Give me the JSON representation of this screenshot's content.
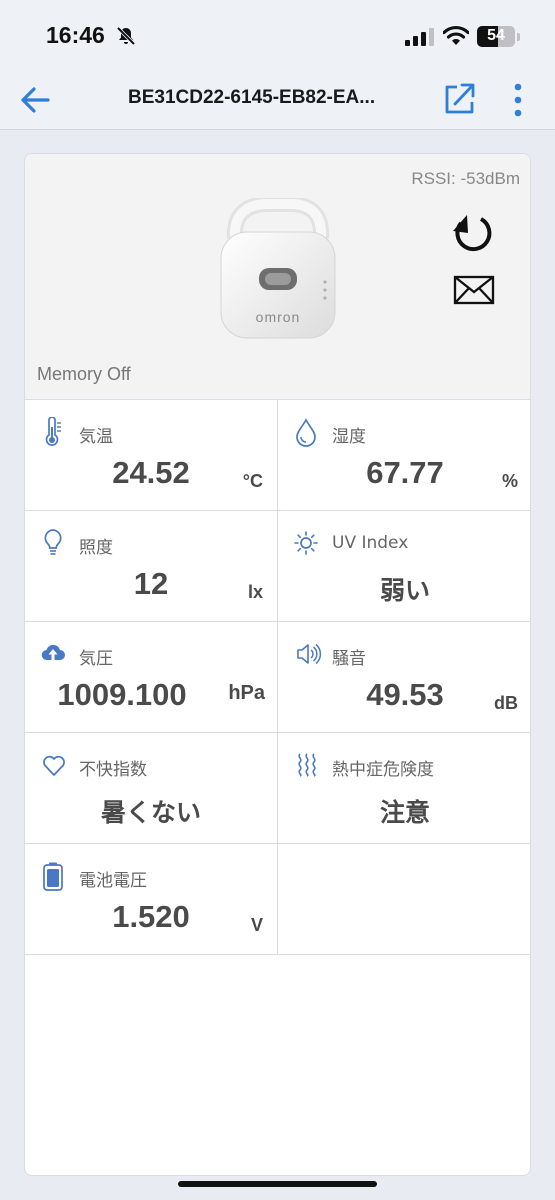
{
  "status_bar": {
    "time": "16:46",
    "battery_level": "54"
  },
  "nav": {
    "title": "BE31CD22-6145-EB82-EA..."
  },
  "device": {
    "rssi": "RSSI: -53dBm",
    "brand_label": "omron",
    "memory_status": "Memory Off"
  },
  "sensors": [
    {
      "label": "気温",
      "value": "24.52",
      "unit": "°C",
      "icon": "thermometer-icon"
    },
    {
      "label": "湿度",
      "value": "67.77",
      "unit": "%",
      "icon": "water-drop-icon"
    },
    {
      "label": "照度",
      "value": "12",
      "unit": "lx",
      "icon": "light-bulb-icon"
    },
    {
      "label": "UV Index",
      "value": "弱い",
      "unit": "",
      "icon": "sun-icon"
    },
    {
      "label": "気圧",
      "value": "1009.100",
      "unit": "hPa",
      "icon": "cloud-upload-icon"
    },
    {
      "label": "騒音",
      "value": "49.53",
      "unit": "dB",
      "icon": "speaker-icon"
    },
    {
      "label": "不快指数",
      "value": "暑くない",
      "unit": "",
      "icon": "heart-icon"
    },
    {
      "label": "熱中症危険度",
      "value": "注意",
      "unit": "",
      "icon": "heat-waves-icon"
    },
    {
      "label": "電池電圧",
      "value": "1.520",
      "unit": "V",
      "icon": "battery-icon"
    }
  ],
  "colors": {
    "accent": "#2f7fd8",
    "icon_blue": "#4a78c2",
    "text_value": "#4a4a4a",
    "text_label": "#666666"
  }
}
